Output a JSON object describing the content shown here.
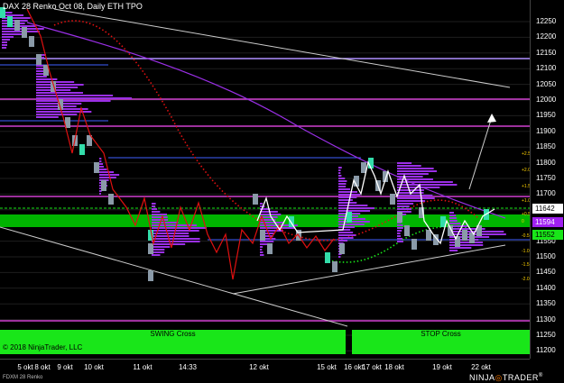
{
  "window": {
    "title": "DAX 28 Renko Oct 08, Daily ETH TPO"
  },
  "price_axis": {
    "ticks": [
      "12250",
      "12200",
      "12150",
      "12100",
      "12050",
      "12000",
      "11950",
      "11900",
      "11850",
      "11800",
      "11750",
      "11700",
      "11650",
      "11600",
      "11550",
      "11500",
      "11450",
      "11400",
      "11350",
      "11300",
      "11250",
      "11200"
    ],
    "tags": [
      {
        "label": "11642",
        "bg": "#ffffff",
        "fg": "#000000"
      },
      {
        "label": "11594",
        "bg": "#a020f0",
        "fg": "#ffffff"
      },
      {
        "label": "11552",
        "bg": "#19e619",
        "fg": "#000000"
      }
    ]
  },
  "time_axis": {
    "ticks": [
      "5 okt",
      "8 okt",
      "9 okt",
      "10 okt",
      "11 okt",
      "14:33",
      "12 okt",
      "15 okt",
      "16 okt",
      "17 okt",
      "18 okt",
      "19 okt",
      "22 okt"
    ]
  },
  "level_labels": [
    "+2.5",
    "+2.0",
    "+1.5",
    "+1.0",
    "+0.5",
    "0",
    "-0.5",
    "-1.0",
    "-1.5",
    "-2.0"
  ],
  "signals": {
    "swing": "SWING Cross",
    "stop": "STOP Cross"
  },
  "copyright": "© 2018 NinjaTrader, LLC",
  "footer_label": "FDXM 28 Renko",
  "brand": {
    "part1": "NINJA",
    "part2": "TRADER",
    "mark": "®"
  },
  "colors": {
    "background": "#000000",
    "magenta_levels": "#e040e0",
    "tpo_profile": "#9a2fe6",
    "renko_down": "#8a9aa8",
    "renko_up": "#33ddaa",
    "signal_green": "#19e619",
    "line_red": "#e01010",
    "line_white": "#ffffff",
    "value_area_green": "#00c800"
  }
}
